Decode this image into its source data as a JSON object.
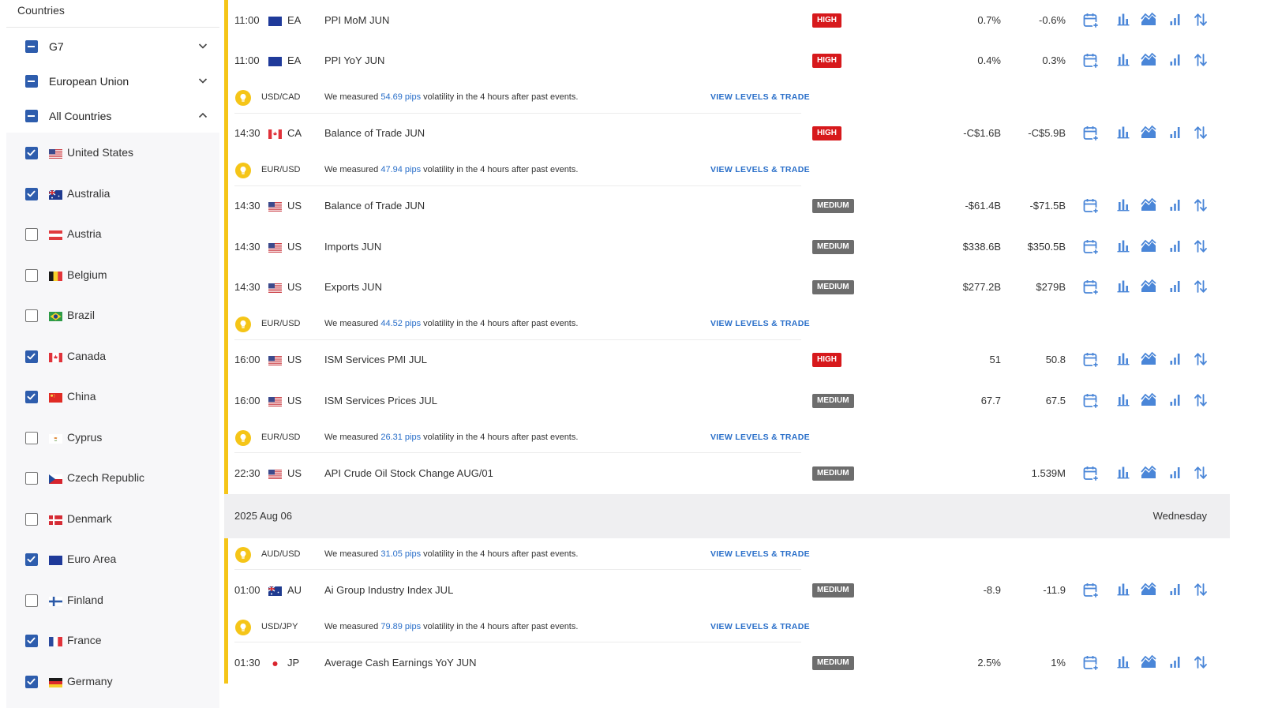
{
  "sidebar": {
    "title": "Countries",
    "groups": [
      {
        "label": "G7",
        "state": "mixed",
        "chevron": "chevron-down-icon"
      },
      {
        "label": "European Union",
        "state": "mixed",
        "chevron": "chevron-down-icon"
      },
      {
        "label": "All Countries",
        "state": "mixed",
        "chevron": "chevron-up-icon"
      }
    ],
    "countries": [
      {
        "name": "United States",
        "checked": true,
        "flag": "us"
      },
      {
        "name": "Australia",
        "checked": true,
        "flag": "au"
      },
      {
        "name": "Austria",
        "checked": false,
        "flag": "at"
      },
      {
        "name": "Belgium",
        "checked": false,
        "flag": "be"
      },
      {
        "name": "Brazil",
        "checked": false,
        "flag": "br"
      },
      {
        "name": "Canada",
        "checked": true,
        "flag": "ca"
      },
      {
        "name": "China",
        "checked": true,
        "flag": "cn"
      },
      {
        "name": "Cyprus",
        "checked": false,
        "flag": "cy"
      },
      {
        "name": "Czech Republic",
        "checked": false,
        "flag": "cz"
      },
      {
        "name": "Denmark",
        "checked": false,
        "flag": "dk"
      },
      {
        "name": "Euro Area",
        "checked": true,
        "flag": "eu"
      },
      {
        "name": "Finland",
        "checked": false,
        "flag": "fi"
      },
      {
        "name": "France",
        "checked": true,
        "flag": "fr"
      },
      {
        "name": "Germany",
        "checked": true,
        "flag": "de"
      }
    ]
  },
  "calendar": {
    "vol_text_prefix": "We measured ",
    "vol_text_suffix": " volatility in the 4 hours after past events.",
    "vol_link": "VIEW LEVELS & TRADE",
    "rows": [
      {
        "kind": "event",
        "time": "11:00",
        "flag": "eu",
        "cc": "EA",
        "title": "PPI MoM JUN",
        "importance": "HIGH",
        "actual": "0.7%",
        "forecast": "-0.6%"
      },
      {
        "kind": "event",
        "time": "11:00",
        "flag": "eu",
        "cc": "EA",
        "title": "PPI YoY JUN",
        "importance": "HIGH",
        "actual": "0.4%",
        "forecast": "0.3%"
      },
      {
        "kind": "vol",
        "pair": "USD/CAD",
        "pips": "54.69 pips"
      },
      {
        "kind": "event",
        "time": "14:30",
        "flag": "ca",
        "cc": "CA",
        "title": "Balance of Trade JUN",
        "importance": "HIGH",
        "actual": "-C$1.6B",
        "forecast": "-C$5.9B"
      },
      {
        "kind": "vol",
        "pair": "EUR/USD",
        "pips": "47.94 pips"
      },
      {
        "kind": "event",
        "time": "14:30",
        "flag": "us",
        "cc": "US",
        "title": "Balance of Trade JUN",
        "importance": "MEDIUM",
        "actual": "-$61.4B",
        "forecast": "-$71.5B"
      },
      {
        "kind": "event",
        "time": "14:30",
        "flag": "us",
        "cc": "US",
        "title": "Imports JUN",
        "importance": "MEDIUM",
        "actual": "$338.6B",
        "forecast": "$350.5B"
      },
      {
        "kind": "event",
        "time": "14:30",
        "flag": "us",
        "cc": "US",
        "title": "Exports JUN",
        "importance": "MEDIUM",
        "actual": "$277.2B",
        "forecast": "$279B"
      },
      {
        "kind": "vol",
        "pair": "EUR/USD",
        "pips": "44.52 pips"
      },
      {
        "kind": "event",
        "time": "16:00",
        "flag": "us",
        "cc": "US",
        "title": "ISM Services PMI JUL",
        "importance": "HIGH",
        "actual": "51",
        "forecast": "50.8"
      },
      {
        "kind": "event",
        "time": "16:00",
        "flag": "us",
        "cc": "US",
        "title": "ISM Services Prices JUL",
        "importance": "MEDIUM",
        "actual": "67.7",
        "forecast": "67.5"
      },
      {
        "kind": "vol",
        "pair": "EUR/USD",
        "pips": "26.31 pips"
      },
      {
        "kind": "event",
        "time": "22:30",
        "flag": "us",
        "cc": "US",
        "title": "API Crude Oil Stock Change AUG/01",
        "importance": "MEDIUM",
        "actual": "",
        "forecast": "1.539M"
      },
      {
        "kind": "date",
        "date": "2025 Aug 06",
        "day": "Wednesday"
      },
      {
        "kind": "vol",
        "pair": "AUD/USD",
        "pips": "31.05 pips"
      },
      {
        "kind": "event",
        "time": "01:00",
        "flag": "au",
        "cc": "AU",
        "title": "Ai Group Industry Index JUL",
        "importance": "MEDIUM",
        "actual": "-8.9",
        "forecast": "-11.9"
      },
      {
        "kind": "vol",
        "pair": "USD/JPY",
        "pips": "79.89 pips"
      },
      {
        "kind": "event",
        "time": "01:30",
        "flag": "jp",
        "cc": "JP",
        "title": "Average Cash Earnings YoY JUN",
        "importance": "MEDIUM",
        "actual": "2.5%",
        "forecast": "1%"
      }
    ],
    "row_icons": [
      "calendar-add-icon",
      "bar-chart-icon",
      "area-chart-icon",
      "signal-bars-icon",
      "sort-arrows-icon"
    ],
    "colors": {
      "accent_bar": "#f5c518",
      "high": "#d7191c",
      "medium": "#6d6d6d",
      "link": "#2a6fc9",
      "icon": "#4a86d8"
    }
  }
}
